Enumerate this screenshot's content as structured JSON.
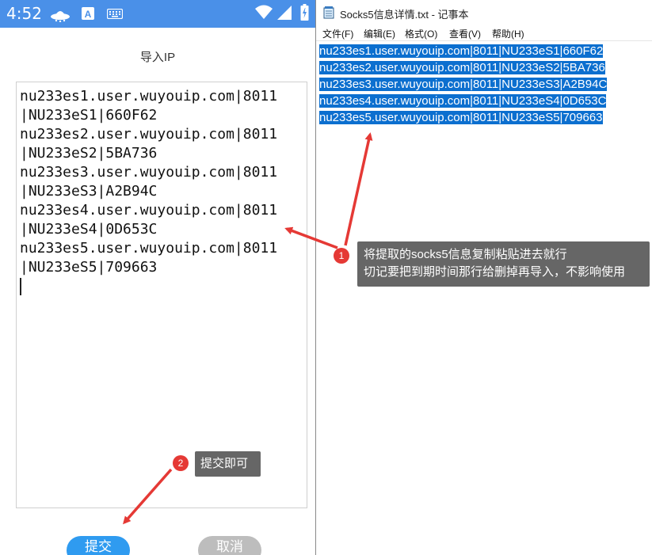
{
  "status_bar": {
    "time": "4:52",
    "bg_color": "#4a90e8",
    "icons": [
      "ufo-icon",
      "a-icon",
      "keyboard-icon",
      "wifi-icon",
      "signal-icon",
      "battery-icon"
    ]
  },
  "phone": {
    "title": "导入IP",
    "textarea_lines": [
      "nu233es1.user.wuyouip.com|8011",
      "|NU233eS1|660F62",
      "nu233es2.user.wuyouip.com|8011",
      "|NU233eS2|5BA736",
      "nu233es3.user.wuyouip.com|8011",
      "|NU233eS3|A2B94C",
      "nu233es4.user.wuyouip.com|8011",
      "|NU233eS4|0D653C",
      "nu233es5.user.wuyouip.com|8011",
      "|NU233eS5|709663"
    ],
    "submit_label": "提交",
    "cancel_label": "取消",
    "submit_color": "#2f9bf0",
    "cancel_color": "#bdbdbd"
  },
  "notepad": {
    "title": "Socks5信息详情.txt - 记事本",
    "menu": [
      "文件(F)",
      "编辑(E)",
      "格式(O)",
      "查看(V)",
      "帮助(H)"
    ],
    "lines": [
      "nu233es1.user.wuyouip.com|8011|NU233eS1|660F62",
      "nu233es2.user.wuyouip.com|8011|NU233eS2|5BA736",
      "nu233es3.user.wuyouip.com|8011|NU233eS3|A2B94C",
      "nu233es4.user.wuyouip.com|8011|NU233eS4|0D653C",
      "nu233es5.user.wuyouip.com|8011|NU233eS5|709663"
    ],
    "selection_color": "#0c6fcf"
  },
  "annotations": {
    "callout1_num": "1",
    "callout1_line1": "将提取的socks5信息复制粘贴进去就行",
    "callout1_line2": "切记要把到期时间那行给删掉再导入，不影响使用",
    "callout2_num": "2",
    "callout2_text": "提交即可",
    "arrow_color": "#e53935"
  }
}
